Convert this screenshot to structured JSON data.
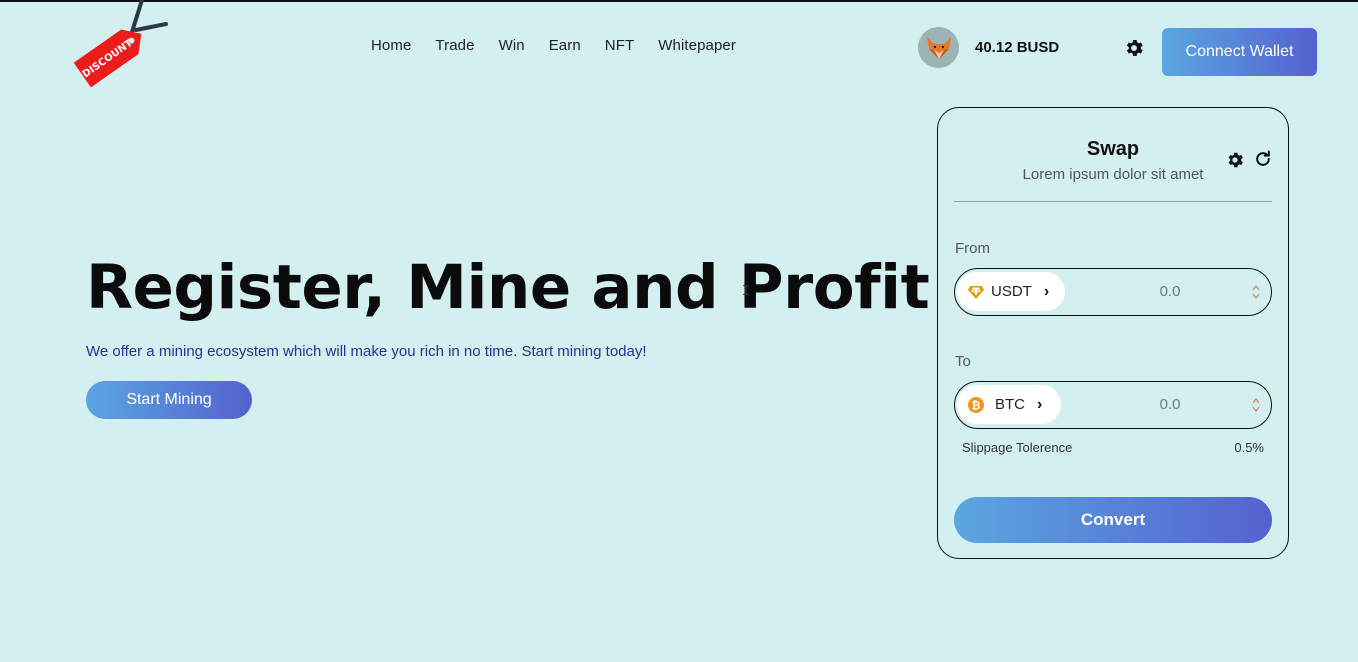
{
  "logo": {
    "tag_text": "DISCOUNT"
  },
  "nav": {
    "items": [
      "Home",
      "Trade",
      "Win",
      "Earn",
      "NFT",
      "Whitepaper"
    ]
  },
  "header": {
    "avatar_icon": "fox-icon",
    "balance": "40.12 BUSD",
    "settings_icon": "gear-icon",
    "connect_label": "Connect Wallet"
  },
  "hero": {
    "title": "Register, Mine and Profit",
    "subtitle": "We offer a mining ecosystem which will make you rich in no time. Start mining today!",
    "cta_label": "Start Mining"
  },
  "swap": {
    "title": "Swap",
    "subtitle": "Lorem ipsum dolor sit amet",
    "from": {
      "label": "From",
      "token": "USDT",
      "token_icon": "tether-icon",
      "placeholder": "0.0"
    },
    "to": {
      "label": "To",
      "token": "BTC",
      "token_icon": "bitcoin-icon",
      "placeholder": "0.0"
    },
    "slippage_label": "Slippage Tolerence",
    "slippage_value": "0.5%",
    "convert_label": "Convert"
  },
  "colors": {
    "background": "#d3eff0",
    "gradient_start": "#5aa6e0",
    "gradient_end": "#5561d0",
    "tag_red": "#ee1b1b",
    "tether_gold": "#e0a10c",
    "bitcoin_orange": "#f7931a"
  }
}
